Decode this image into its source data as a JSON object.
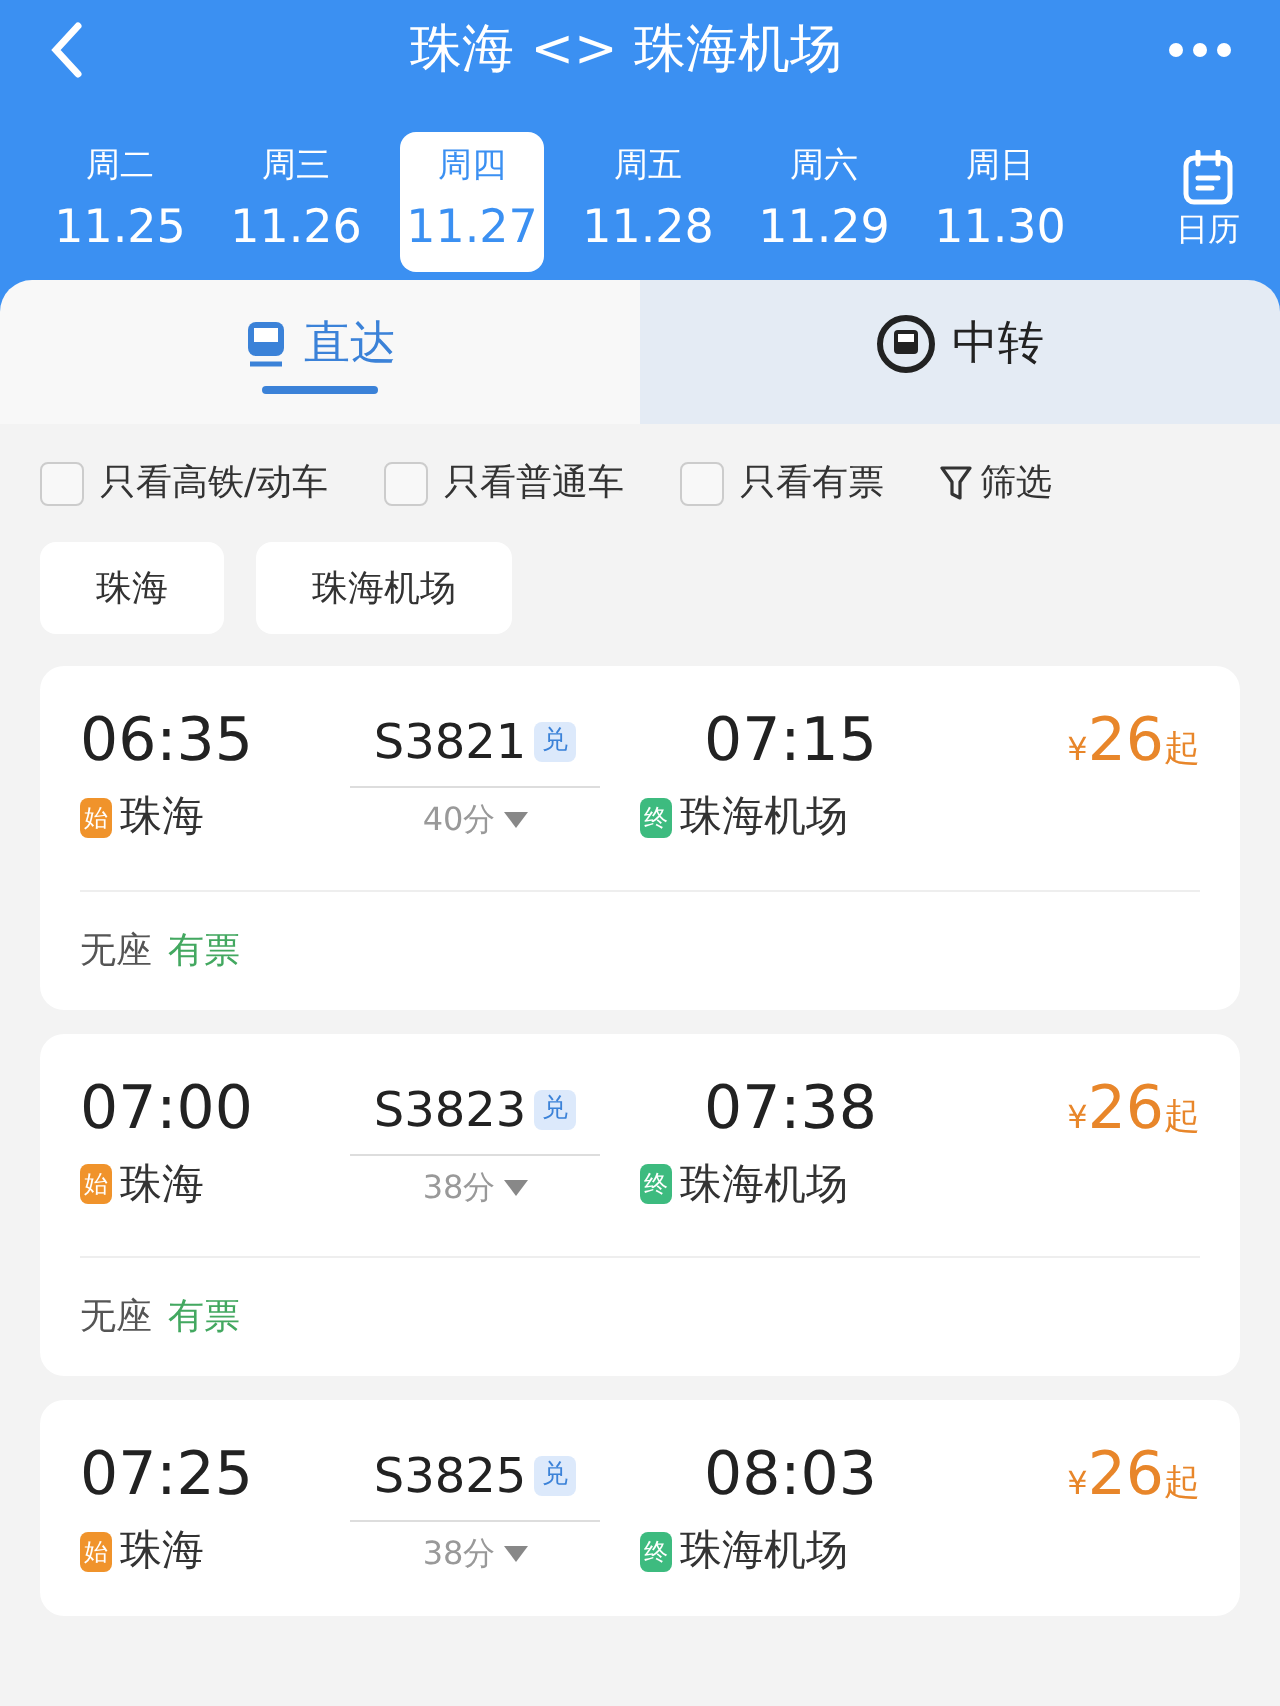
{
  "header": {
    "title": "珠海 <> 珠海机场"
  },
  "dates": [
    {
      "weekday": "周二",
      "date": "11.25",
      "selected": false
    },
    {
      "weekday": "周三",
      "date": "11.26",
      "selected": false
    },
    {
      "weekday": "周四",
      "date": "11.27",
      "selected": true
    },
    {
      "weekday": "周五",
      "date": "11.28",
      "selected": false
    },
    {
      "weekday": "周六",
      "date": "11.29",
      "selected": false
    },
    {
      "weekday": "周日",
      "date": "11.30",
      "selected": false
    }
  ],
  "calendar": {
    "label": "日历"
  },
  "tabs": [
    {
      "label": "直达",
      "selected": true
    },
    {
      "label": "中转",
      "selected": false
    }
  ],
  "filters": [
    {
      "label": "只看高铁/动车",
      "checked": false
    },
    {
      "label": "只看普通车",
      "checked": false
    },
    {
      "label": "只看有票",
      "checked": false
    }
  ],
  "filter_button": {
    "label": "筛选"
  },
  "stations": [
    "珠海",
    "珠海机场"
  ],
  "trains": [
    {
      "depart": "06:35",
      "train": "S3821",
      "tag": "兑",
      "arrive": "07:15",
      "price_symbol": "¥",
      "price": "26",
      "price_suffix": "起",
      "start_badge": "始",
      "from": "珠海",
      "duration": "40分",
      "end_badge": "终",
      "to": "珠海机场",
      "seat": "无座",
      "availability": "有票"
    },
    {
      "depart": "07:00",
      "train": "S3823",
      "tag": "兑",
      "arrive": "07:38",
      "price_symbol": "¥",
      "price": "26",
      "price_suffix": "起",
      "start_badge": "始",
      "from": "珠海",
      "duration": "38分",
      "end_badge": "终",
      "to": "珠海机场",
      "seat": "无座",
      "availability": "有票"
    },
    {
      "depart": "07:25",
      "train": "S3825",
      "tag": "兑",
      "arrive": "08:03",
      "price_symbol": "¥",
      "price": "26",
      "price_suffix": "起",
      "start_badge": "始",
      "from": "珠海",
      "duration": "38分",
      "end_badge": "终",
      "to": "珠海机场"
    }
  ]
}
